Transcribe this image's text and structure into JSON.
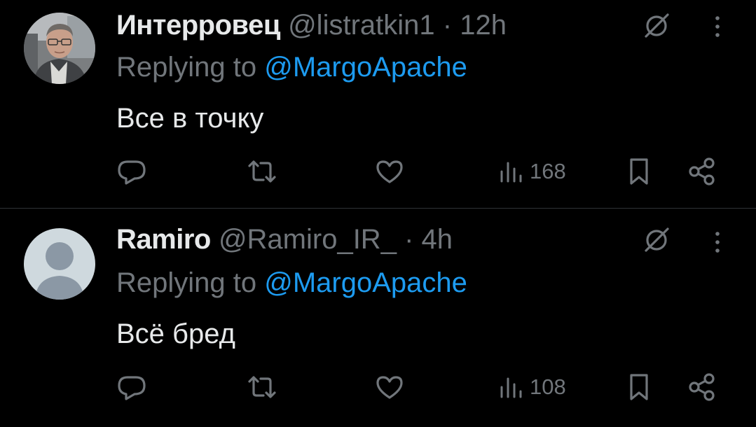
{
  "tweets": [
    {
      "name": "Интерровец",
      "handle": "@listratkin1",
      "separator": "·",
      "time": "12h",
      "reply_prefix": "Replying to",
      "reply_to": "@MargoApache",
      "text": "Все в точку",
      "views": "168",
      "avatar": "user-photo"
    },
    {
      "name": "Ramiro",
      "handle": "@Ramiro_IR_",
      "separator": "·",
      "time": "4h",
      "reply_prefix": "Replying to",
      "reply_to": "@MargoApache",
      "text": "Всё бред",
      "views": "108",
      "avatar": "default-avatar"
    }
  ],
  "icons": [
    "grok-icon",
    "more-icon",
    "reply-icon",
    "retweet-icon",
    "like-icon",
    "views-icon",
    "bookmark-icon",
    "share-icon"
  ],
  "colors": {
    "background": "#000000",
    "text": "#e7e9ea",
    "muted": "#71767b",
    "link": "#1d9bf0",
    "divider": "#2f3336"
  }
}
